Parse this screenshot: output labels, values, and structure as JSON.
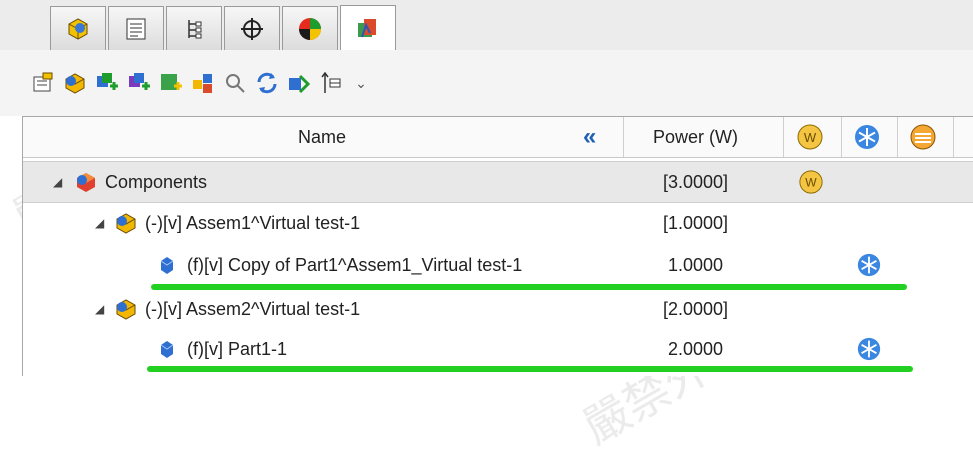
{
  "tabs": [
    {
      "icon": "feature-manager-icon"
    },
    {
      "icon": "property-manager-icon"
    },
    {
      "icon": "configuration-manager-icon"
    },
    {
      "icon": "dimxpert-icon"
    },
    {
      "icon": "display-manager-icon"
    },
    {
      "icon": "thermal-power-icon"
    }
  ],
  "toolbar": {
    "icons": [
      "properties-icon",
      "component-icon",
      "add-component-icon",
      "add-assembly-icon",
      "add-node-icon",
      "group-icon",
      "zoom-icon",
      "refresh-icon",
      "link-icon",
      "sort-icon"
    ],
    "overflow": "⌄"
  },
  "header": {
    "name": "Name",
    "collapse": "«",
    "power": "Power (W)"
  },
  "rows": [
    {
      "label": "Components",
      "value": "[3.0000]"
    },
    {
      "label": "(-)[v] Assem1^Virtual test-1",
      "value": "[1.0000]"
    },
    {
      "label": "(f)[v] Copy of Part1^Assem1_Virtual test-1",
      "value": "1.0000"
    },
    {
      "label": "(-)[v] Assem2^Virtual test-1",
      "value": "[2.0000]"
    },
    {
      "label": "(f)[v] Part1-1",
      "value": "2.0000"
    }
  ],
  "watermark": "嚴禁外流 勢流機密",
  "colors": {
    "highlight": "#22d022",
    "accent": "#1f5fb8"
  }
}
